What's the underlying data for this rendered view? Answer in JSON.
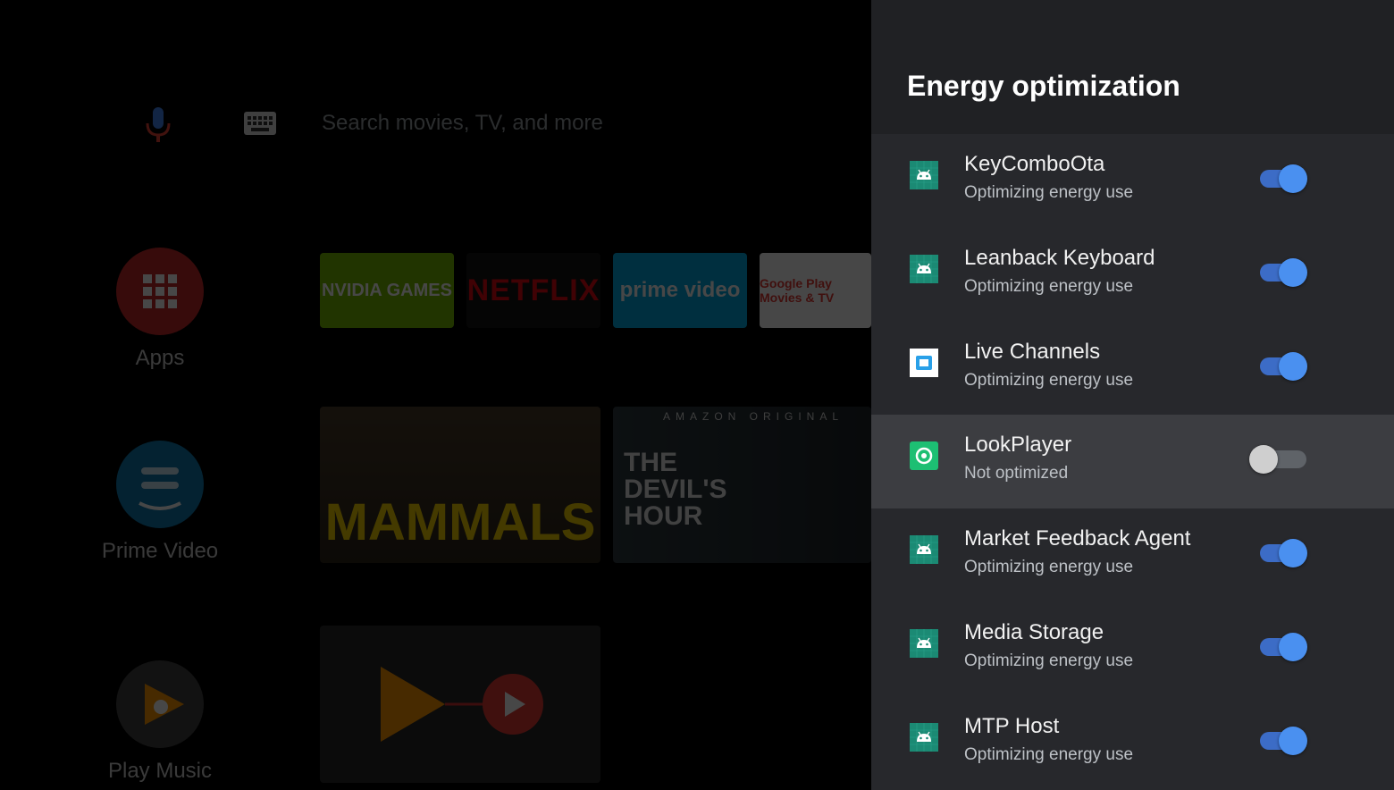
{
  "launcher": {
    "search_placeholder": "Search movies, TV, and more",
    "side_items": [
      {
        "label": "Apps",
        "color": "#c62828"
      },
      {
        "label": "Prime Video",
        "color": "#0f79af"
      },
      {
        "label": "Play Music",
        "color": "#424242"
      }
    ],
    "app_tiles": [
      {
        "label": "NVIDIA GAMES",
        "bg": "#76b900",
        "fg": "#ffffff"
      },
      {
        "label": "NETFLIX",
        "bg": "#141414",
        "fg": "#e50914"
      },
      {
        "label": "prime video",
        "bg": "#00a8e1",
        "fg": "#ffffff"
      },
      {
        "label": "Google Play Movies & TV",
        "bg": "#ffffff",
        "fg": "#e53935"
      }
    ],
    "featured": [
      {
        "title": "MAMMALS"
      },
      {
        "kicker": "AMAZON ORIGINAL",
        "title": "THE DEVIL'S HOUR"
      }
    ]
  },
  "panel": {
    "title": "Energy optimization",
    "apps": [
      {
        "name": "KeyComboOta",
        "status": "Optimizing energy use",
        "enabled": true,
        "icon": "android-icon",
        "focused": false
      },
      {
        "name": "Leanback Keyboard",
        "status": "Optimizing energy use",
        "enabled": true,
        "icon": "android-icon",
        "focused": false
      },
      {
        "name": "Live Channels",
        "status": "Optimizing energy use",
        "enabled": true,
        "icon": "live-channels-icon",
        "focused": false
      },
      {
        "name": "LookPlayer",
        "status": "Not optimized",
        "enabled": false,
        "icon": "lookplayer-icon",
        "focused": true
      },
      {
        "name": "Market Feedback Agent",
        "status": "Optimizing energy use",
        "enabled": true,
        "icon": "android-icon",
        "focused": false
      },
      {
        "name": "Media Storage",
        "status": "Optimizing energy use",
        "enabled": true,
        "icon": "android-icon",
        "focused": false
      },
      {
        "name": "MTP Host",
        "status": "Optimizing energy use",
        "enabled": true,
        "icon": "android-icon",
        "focused": false
      }
    ]
  },
  "colors": {
    "panel_bg": "#202124",
    "toggle_on": "#4a90f0",
    "toggle_off": "#cfcfcf",
    "android_icon_bg": "#1b8a74"
  }
}
